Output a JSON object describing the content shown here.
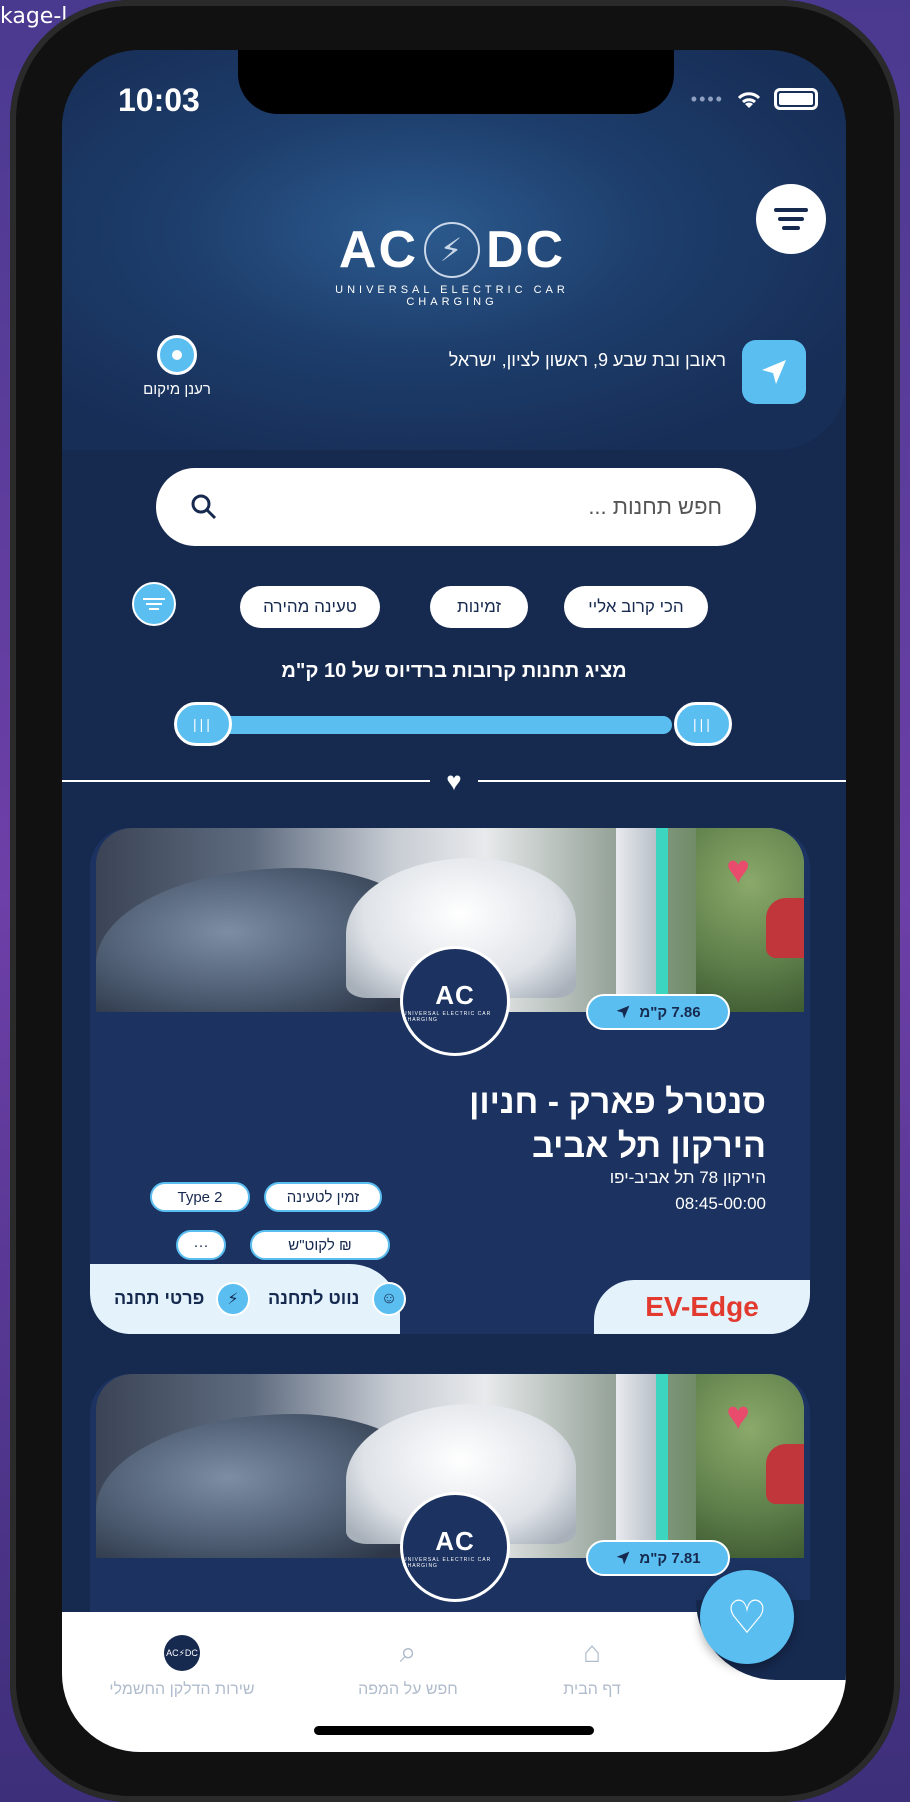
{
  "status": {
    "time": "10:03"
  },
  "header": {
    "logo_text_left": "AC",
    "logo_text_right": "DC",
    "logo_subtitle": "UNIVERSAL ELECTRIC CAR CHARGING",
    "address": "ראובן ובת שבע 9, ראשון לציון, ישראל",
    "refresh_label": "רענן מיקום"
  },
  "search": {
    "placeholder": "חפש תחנות ..."
  },
  "filters": {
    "chips": [
      "הכי קרוב אליי",
      "זמינות",
      "טעינה מהירה"
    ]
  },
  "radius": {
    "text": "מציג תחנות קרובות ברדיוס של 10 ק\"מ",
    "value_km": 10
  },
  "cards": [
    {
      "distance": "7.86 ק\"מ",
      "title": "סנטרל פארק - חניון הירקון תל אביב",
      "address": "הירקון 78 תל אביב-יפו",
      "hours": "08:45-00:00",
      "tag_available": "זמין לטעינה",
      "tag_type": "Type 2",
      "tag_price": "₪ לקוט\"ש",
      "tag_more": "···",
      "waze_label": "נווט לתחנה",
      "details_label": "פרטי תחנה",
      "provider": "EV-Edge"
    },
    {
      "distance": "7.81 ק\"מ"
    }
  ],
  "tabbar": {
    "home": "דף הבית",
    "map": "חפש על המפה",
    "service": "שירות הדלקן החשמלי"
  },
  "colors": {
    "accent": "#5bbef0",
    "bg": "#16294f",
    "provider": "#e23a2f",
    "heart": "#e94b6c"
  }
}
